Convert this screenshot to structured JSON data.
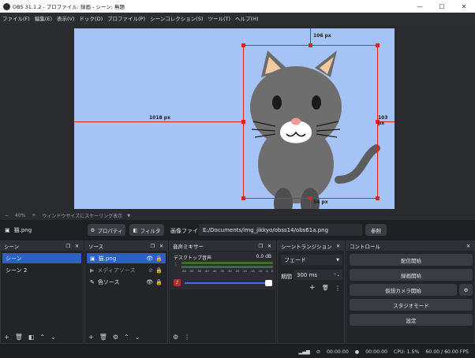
{
  "window": {
    "title": "OBS 31.1.2 - プロファイル: 録画 - シーン: 無題",
    "minimize": "—",
    "maximize": "☐",
    "close": "✕"
  },
  "menu": [
    "ファイル(F)",
    "編集(E)",
    "表示(V)",
    "ドック(D)",
    "プロファイル(P)",
    "シーンコレクション(S)",
    "ツール(T)",
    "ヘルプ(H)"
  ],
  "preview": {
    "label_top": "106 px",
    "label_left": "1018 px",
    "label_right": "103 px",
    "label_bottom": "54 px",
    "canvas_color": "#a6c3f6",
    "accent": "#e0231c"
  },
  "zoom": {
    "minus": "−",
    "value": "40%",
    "plus": "+",
    "mode": "ウィンドウサイズにスケーリング表示"
  },
  "source_bar": {
    "name": "猫.png",
    "properties": "プロパティ",
    "filter": "フィルタ",
    "file_label": "画像ファイル",
    "file_path": "E:/Documents/img_jikkyo/obss14/obs61a.png",
    "browse": "参照"
  },
  "scenes": {
    "title": "シーン",
    "items": [
      "シーン",
      "シーン 2"
    ]
  },
  "sources": {
    "title": "ソース",
    "items": [
      "猫.png",
      "メディアソース",
      "色ソース"
    ]
  },
  "mixer": {
    "title": "音声ミキサー",
    "track": "デスクトップ音声",
    "db": "0.0 dB",
    "scale": [
      "-60",
      "-55",
      "-50",
      "-45",
      "-40",
      "-35",
      "-30",
      "-25",
      "-20",
      "-15",
      "-10",
      "-5",
      "0"
    ]
  },
  "transitions": {
    "title": "シーントランジション",
    "type": "フェード",
    "duration_label": "期間",
    "duration": "300 ms"
  },
  "controls": {
    "title": "コントロール",
    "stream": "配信開始",
    "record": "録画開始",
    "vcam": "仮想カメラ開始",
    "studio": "スタジオモード",
    "settings": "設定"
  },
  "status": {
    "stream_time": "00:00:00",
    "rec_time": "00:00:00",
    "cpu": "CPU: 1.5%",
    "fps": "60.00 / 60.00 FPS"
  }
}
